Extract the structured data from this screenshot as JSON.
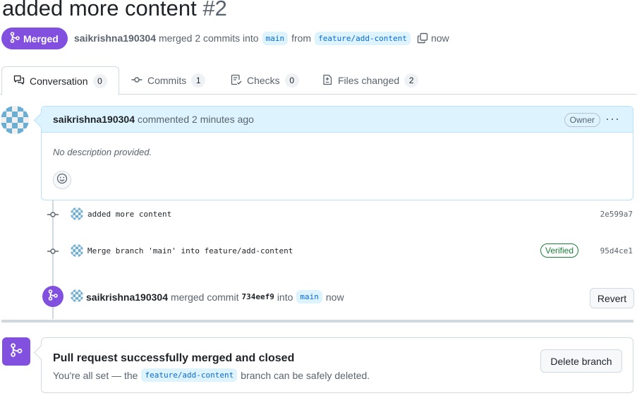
{
  "pr": {
    "title": "added more content",
    "number": "#2",
    "state": "Merged",
    "author": "saikrishna190304",
    "merge_text_1": "merged 2 commits into",
    "base_branch": "main",
    "merge_text_2": "from",
    "head_branch": "feature/add-content",
    "time": "now"
  },
  "tabs": [
    {
      "label": "Conversation",
      "count": "0",
      "icon": "comment-discussion-icon"
    },
    {
      "label": "Commits",
      "count": "1",
      "icon": "git-commit-icon"
    },
    {
      "label": "Checks",
      "count": "0",
      "icon": "checklist-icon"
    },
    {
      "label": "Files changed",
      "count": "2",
      "icon": "file-diff-icon"
    }
  ],
  "comment": {
    "author": "saikrishna190304",
    "action": "commented 2 minutes ago",
    "badge": "Owner",
    "body": "No description provided.",
    "menu": "···"
  },
  "commits": [
    {
      "message": "added more content",
      "sha": "2e599a7",
      "verified": ""
    },
    {
      "message": "Merge branch 'main' into feature/add-content",
      "sha": "95d4ce1",
      "verified": "Verified"
    }
  ],
  "merge_event": {
    "author": "saikrishna190304",
    "action": "merged commit",
    "sha": "734eef9",
    "into": "into",
    "branch": "main",
    "time": "now",
    "revert_label": "Revert"
  },
  "merged_box": {
    "title": "Pull request successfully merged and closed",
    "sub_1": "You're all set — the",
    "branch": "feature/add-content",
    "sub_2": "branch can be safely deleted.",
    "delete_label": "Delete branch"
  },
  "colors": {
    "merged_purple": "#8250df",
    "link_blue": "#0969da",
    "verified_green": "#1a7f37",
    "comment_header": "#ddf4ff"
  }
}
